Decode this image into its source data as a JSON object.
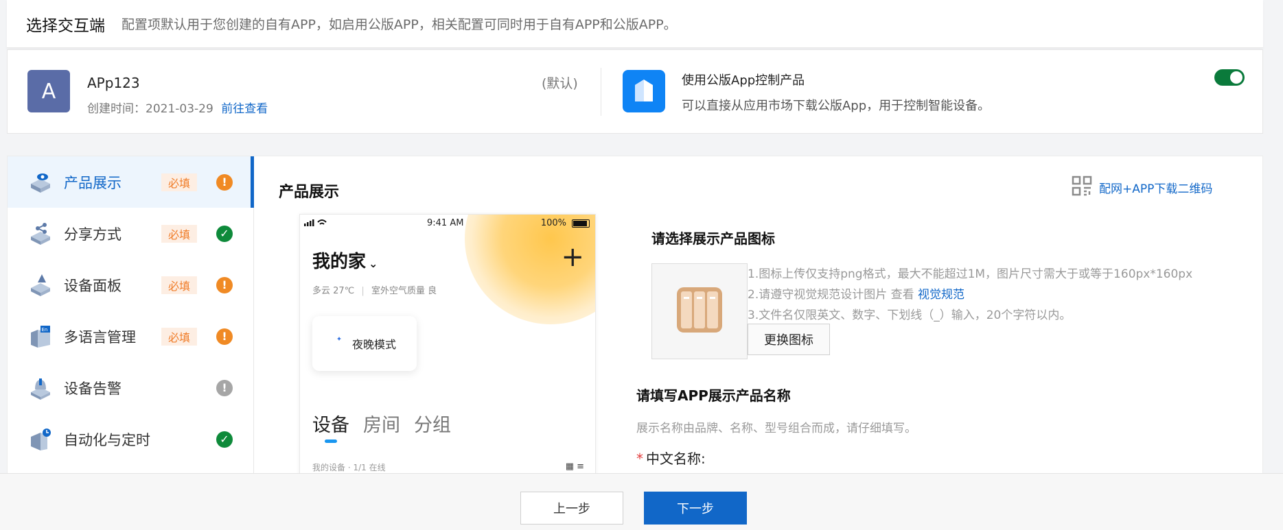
{
  "header": {
    "title": "选择交互端",
    "description": "配置项默认用于您创建的自有APP，如启用公版APP，相关配置可同时用于自有APP和公版APP。"
  },
  "app": {
    "avatar_letter": "A",
    "name": "APp123",
    "created_label": "创建时间：2021-03-29",
    "view_link": "前往查看",
    "default_tag": "(默认)"
  },
  "public_app": {
    "title": "使用公版App控制产品",
    "description": "可以直接从应用市场下载公版App，用于控制智能设备。",
    "enabled": true,
    "toggle_color": "#0a7a3b"
  },
  "sidebar": {
    "items": [
      {
        "label": "产品展示",
        "badge": "必填",
        "status": "warn",
        "status_glyph": "!",
        "icon": "product-display-icon",
        "active": true
      },
      {
        "label": "分享方式",
        "badge": "必填",
        "status": "ok",
        "status_glyph": "✓",
        "icon": "share-icon",
        "active": false
      },
      {
        "label": "设备面板",
        "badge": "必填",
        "status": "warn",
        "status_glyph": "!",
        "icon": "device-panel-icon",
        "active": false
      },
      {
        "label": "多语言管理",
        "badge": "必填",
        "status": "warn",
        "status_glyph": "!",
        "icon": "language-icon",
        "active": false
      },
      {
        "label": "设备告警",
        "badge": "",
        "status": "grey",
        "status_glyph": "!",
        "icon": "alarm-icon",
        "active": false
      },
      {
        "label": "自动化与定时",
        "badge": "",
        "status": "ok",
        "status_glyph": "✓",
        "icon": "automation-icon",
        "active": false
      }
    ]
  },
  "content": {
    "title": "产品展示",
    "qr_link": "配网+APP下载二维码"
  },
  "phone": {
    "time": "9:41 AM",
    "battery": "100%",
    "home_title": "我的家",
    "weather_temp": "多云 27℃",
    "weather_air": "室外空气质量 良",
    "scene_label": "夜晚模式",
    "tabs": [
      "设备",
      "房间",
      "分组"
    ],
    "my_devices": "我的设备 · 1/1 在线"
  },
  "icon_section": {
    "title": "请选择展示产品图标",
    "rule1": "1.图标上传仅支持png格式，最大不能超过1M，图片尺寸需大于或等于160px*160px",
    "rule2_prefix": "2.请遵守视觉规范设计图片 查看",
    "rule2_link": "视觉规范",
    "rule3": "3.文件名仅限英文、数字、下划线（_）输入，20个字符以内。",
    "change_button": "更换图标"
  },
  "name_section": {
    "title": "请填写APP展示产品名称",
    "description": "展示名称由品牌、名称、型号组合而成，请仔细填写。",
    "cn_label": "中文名称:",
    "required_mark": "*"
  },
  "footer": {
    "prev": "上一步",
    "next": "下一步"
  },
  "colors": {
    "accent": "#1167c8",
    "warn": "#f08a24",
    "ok": "#0e8a3a"
  }
}
